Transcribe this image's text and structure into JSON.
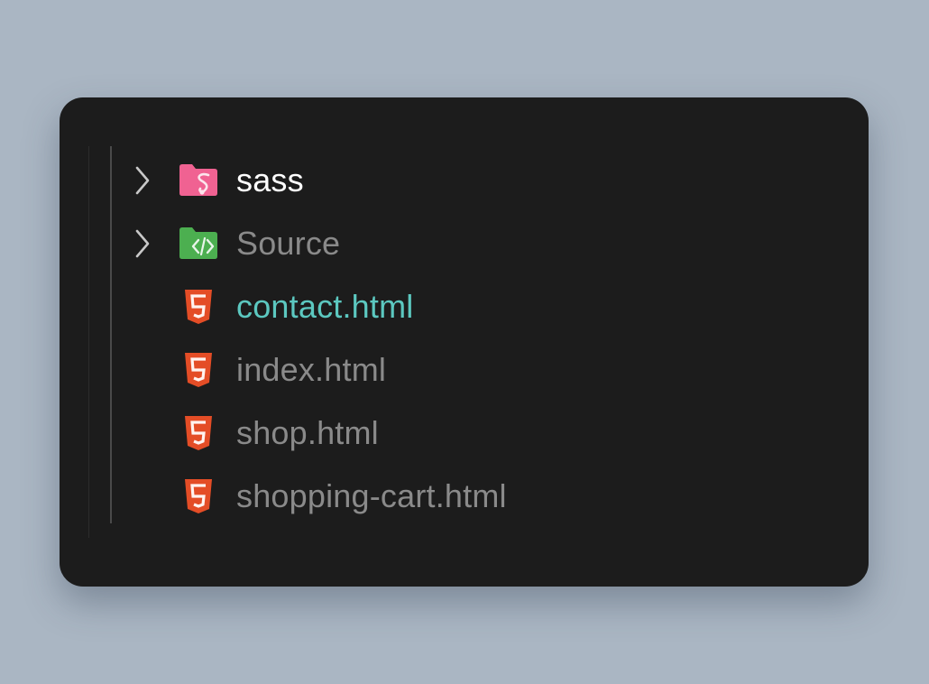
{
  "explorer": {
    "items": [
      {
        "label": "sass",
        "type": "folder",
        "icon": "sass-folder-icon",
        "expandable": true,
        "color": "#ffffff"
      },
      {
        "label": "Source",
        "type": "folder",
        "icon": "source-folder-icon",
        "expandable": true,
        "color": "#8a8a8a"
      },
      {
        "label": "contact.html",
        "type": "file",
        "icon": "html5-icon",
        "expandable": false,
        "color": "#5cc8c0"
      },
      {
        "label": "index.html",
        "type": "file",
        "icon": "html5-icon",
        "expandable": false,
        "color": "#8a8a8a"
      },
      {
        "label": "shop.html",
        "type": "file",
        "icon": "html5-icon",
        "expandable": false,
        "color": "#8a8a8a"
      },
      {
        "label": "shopping-cart.html",
        "type": "file",
        "icon": "html5-icon",
        "expandable": false,
        "color": "#8a8a8a"
      }
    ]
  },
  "colors": {
    "background": "#aab6c3",
    "panel": "#1c1c1c",
    "sass_folder": "#f06292",
    "source_folder": "#4caf50",
    "html5": "#e44d26"
  }
}
